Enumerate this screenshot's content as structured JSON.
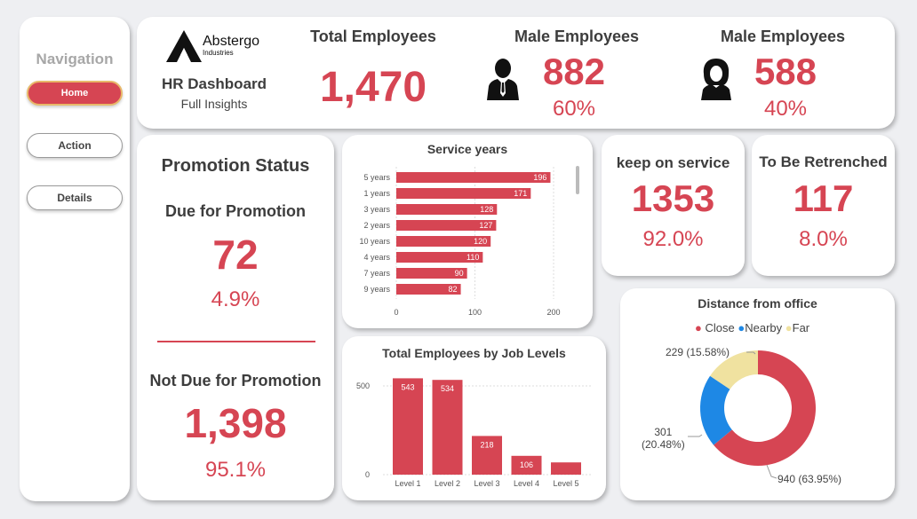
{
  "nav": {
    "title": "Navigation",
    "buttons": [
      {
        "label": "Home",
        "active": true
      },
      {
        "label": "Action",
        "active": false
      },
      {
        "label": "Details",
        "active": false
      }
    ]
  },
  "header": {
    "logo_name": "Abstergo",
    "logo_sub": "Industries",
    "dashboard_title": "HR Dashboard",
    "dashboard_sub": "Full Insights",
    "total": {
      "label": "Total Employees",
      "value": "1,470"
    },
    "male": {
      "label": "Male Employees",
      "value": "882",
      "pct": "60%"
    },
    "female": {
      "label": "Male Employees",
      "value": "588",
      "pct": "40%"
    }
  },
  "promotion": {
    "title": "Promotion Status",
    "due_label": "Due for Promotion",
    "due_value": "72",
    "due_pct": "4.9%",
    "not_due_label": "Not Due for Promotion",
    "not_due_value": "1,398",
    "not_due_pct": "95.1%"
  },
  "keep": {
    "label": "keep on service",
    "value": "1353",
    "pct": "92.0%"
  },
  "retrench": {
    "label": "To Be Retrenched",
    "value": "117",
    "pct": "8.0%"
  },
  "colors": {
    "accent": "#d64553",
    "blue": "#1e88e5",
    "beige": "#f0e2a0"
  },
  "chart_data": [
    {
      "type": "bar",
      "orientation": "horizontal",
      "title": "Service years",
      "categories": [
        "5 years",
        "1 years",
        "3 years",
        "2 years",
        "10 years",
        "4 years",
        "7 years",
        "9 years"
      ],
      "values": [
        196,
        171,
        128,
        127,
        120,
        110,
        90,
        82
      ],
      "x_ticks": [
        "0",
        "100",
        "200"
      ],
      "xlim": [
        0,
        200
      ]
    },
    {
      "type": "bar",
      "title": "Total Employees by Job Levels",
      "categories": [
        "Level 1",
        "Level 2",
        "Level 3",
        "Level 4",
        "Level 5"
      ],
      "values": [
        543,
        534,
        218,
        106,
        69
      ],
      "value_labels": [
        "543",
        "534",
        "218",
        "106",
        ""
      ],
      "y_ticks": [
        "500",
        "0"
      ],
      "ylim": [
        0,
        560
      ]
    },
    {
      "type": "pie",
      "donut": true,
      "title": "Distance from office",
      "legend": [
        "Close",
        "Nearby",
        "Far"
      ],
      "values": [
        940,
        301,
        229
      ],
      "labels": [
        "940 (63.95%)",
        "301\n(20.48%)",
        "229 (15.58%)"
      ]
    }
  ]
}
